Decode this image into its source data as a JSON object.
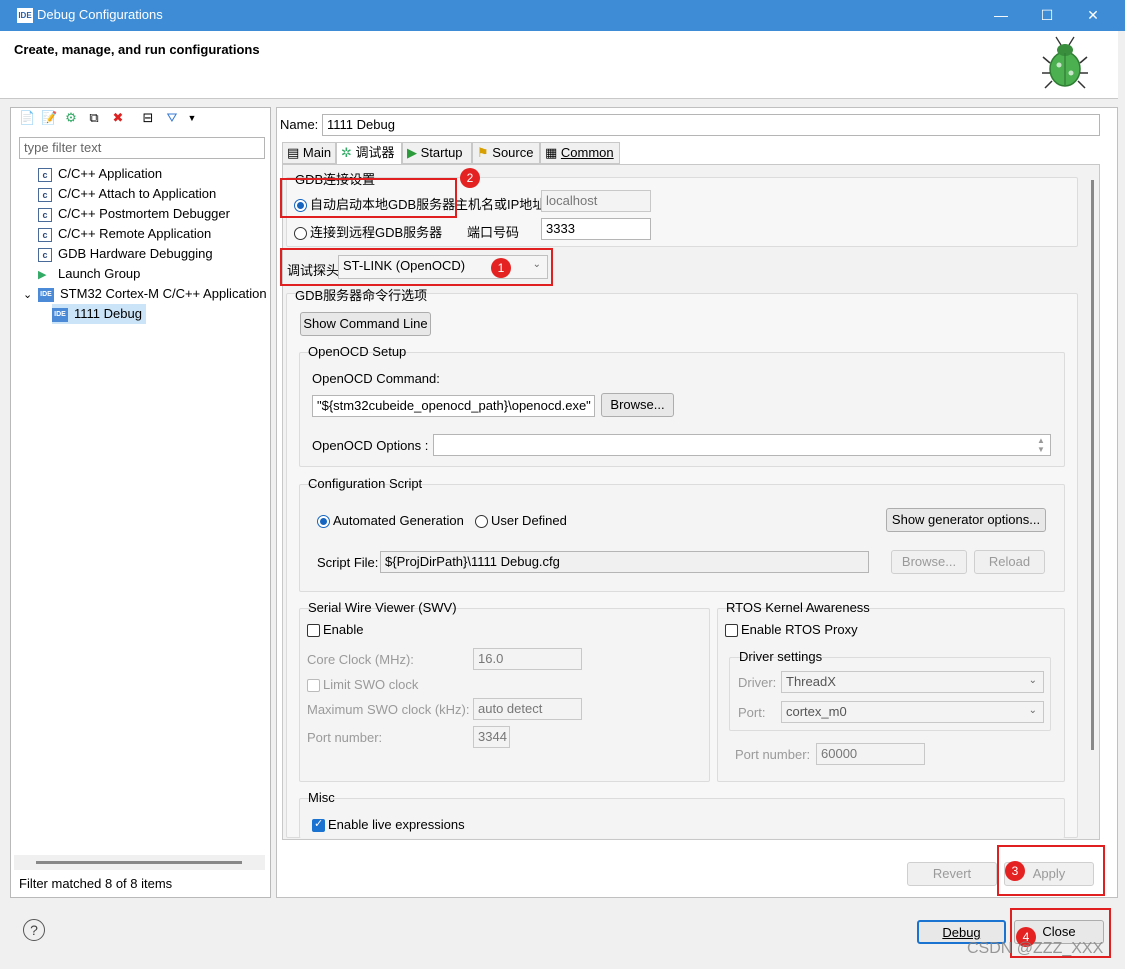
{
  "window": {
    "title": "Debug Configurations",
    "app_icon": "IDE"
  },
  "banner": {
    "heading": "Create, manage, and run configurations",
    "icon": "bug-icon"
  },
  "left": {
    "filter_placeholder": "type filter text",
    "tree": [
      {
        "label": "C/C++ Application",
        "icon": "c-icon"
      },
      {
        "label": "C/C++ Attach to Application",
        "icon": "c-icon"
      },
      {
        "label": "C/C++ Postmortem Debugger",
        "icon": "c-icon"
      },
      {
        "label": "C/C++ Remote Application",
        "icon": "c-icon"
      },
      {
        "label": "GDB Hardware Debugging",
        "icon": "c-icon"
      },
      {
        "label": "Launch Group",
        "icon": "launch-group-icon"
      },
      {
        "label": "STM32 Cortex-M C/C++ Application",
        "icon": "ide-icon"
      },
      {
        "label": "1111 Debug",
        "icon": "ide-icon"
      }
    ],
    "status": "Filter matched 8 of 8 items"
  },
  "config": {
    "name_label": "Name:",
    "name_value": "1111 Debug",
    "tabs": [
      "Main",
      "调试器",
      "Startup",
      "Source",
      "Common"
    ],
    "gdb_group": "GDB连接设置",
    "auto_start": "自动启动本地GDB服务器",
    "connect_remote": "连接到远程GDB服务器",
    "host_label": "主机名或IP地址",
    "host_value": "localhost",
    "port_label": "端口号码",
    "port_value": "3333",
    "probe_label": "调试探头",
    "probe_value": "ST-LINK (OpenOCD)",
    "server_group": "GDB服务器命令行选项",
    "show_cmd": "Show Command Line",
    "openocd_group": "OpenOCD Setup",
    "openocd_cmd_label": "OpenOCD Command:",
    "openocd_cmd_value": "\"${stm32cubeide_openocd_path}\\openocd.exe\"",
    "browse": "Browse...",
    "openocd_opts_label": "OpenOCD Options :",
    "script_group": "Configuration Script",
    "auto_gen": "Automated Generation",
    "user_defined": "User Defined",
    "show_gen": "Show generator options...",
    "script_label": "Script File:",
    "script_value": "${ProjDirPath}\\1111 Debug.cfg",
    "browse2": "Browse...",
    "reload": "Reload",
    "swv_group": "Serial Wire Viewer (SWV)",
    "swv_enable": "Enable",
    "core_clock_label": "Core Clock (MHz):",
    "core_clock_value": "16.0",
    "limit_swo": "Limit SWO clock",
    "max_swo_label": "Maximum SWO clock (kHz):",
    "max_swo_value": "auto detect",
    "swv_port_label": "Port number:",
    "swv_port_value": "3344",
    "rtos_group": "RTOS Kernel Awareness",
    "rtos_enable": "Enable RTOS Proxy",
    "driver_settings": "Driver settings",
    "driver_label": "Driver:",
    "driver_value": "ThreadX",
    "rtos_port_label": "Port:",
    "rtos_port_value": "cortex_m0",
    "rtos_portnum_label": "Port number:",
    "rtos_portnum_value": "60000",
    "misc_group": "Misc",
    "live_expr": "Enable live expressions"
  },
  "buttons": {
    "revert": "Revert",
    "apply": "Apply",
    "debug": "Debug",
    "close": "Close",
    "help": "?"
  },
  "badges": [
    "1",
    "2",
    "3",
    "4"
  ],
  "watermark": "CSDN @ZZZ_XXX",
  "colors": {
    "titlebar": "#3e8cd6",
    "highlight": "#e02020",
    "selection": "#cce4f7"
  }
}
